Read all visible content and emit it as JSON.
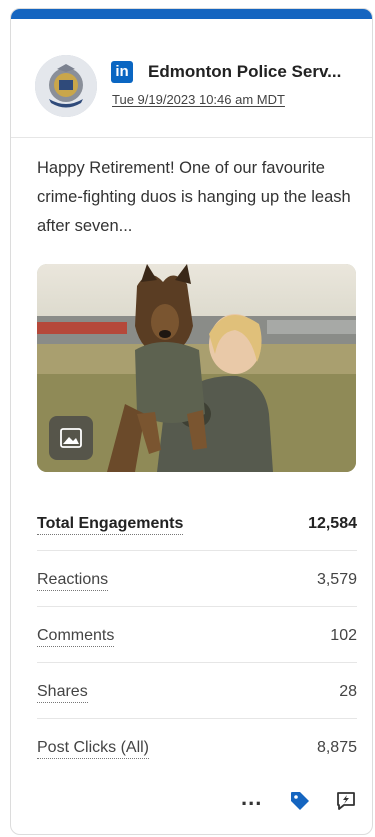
{
  "post": {
    "network": "in",
    "author": "Edmonton Police Serv...",
    "timestamp": "Tue 9/19/2023 10:46 am MDT",
    "body": "Happy Retirement! One of our favourite crime-fighting duos is hanging up the leash after seven..."
  },
  "stats": [
    {
      "label": "Total Engagements",
      "value": "12,584"
    },
    {
      "label": "Reactions",
      "value": "3,579"
    },
    {
      "label": "Comments",
      "value": "102"
    },
    {
      "label": "Shares",
      "value": "28"
    },
    {
      "label": "Post Clicks (All)",
      "value": "8,875"
    }
  ],
  "footer": {
    "more": "...",
    "icons": [
      "more-options-icon",
      "tag-icon",
      "flash-icon"
    ]
  },
  "colors": {
    "top_bar": "#1565c0",
    "linkedin": "#0a66c2",
    "tag": "#1565c0"
  }
}
